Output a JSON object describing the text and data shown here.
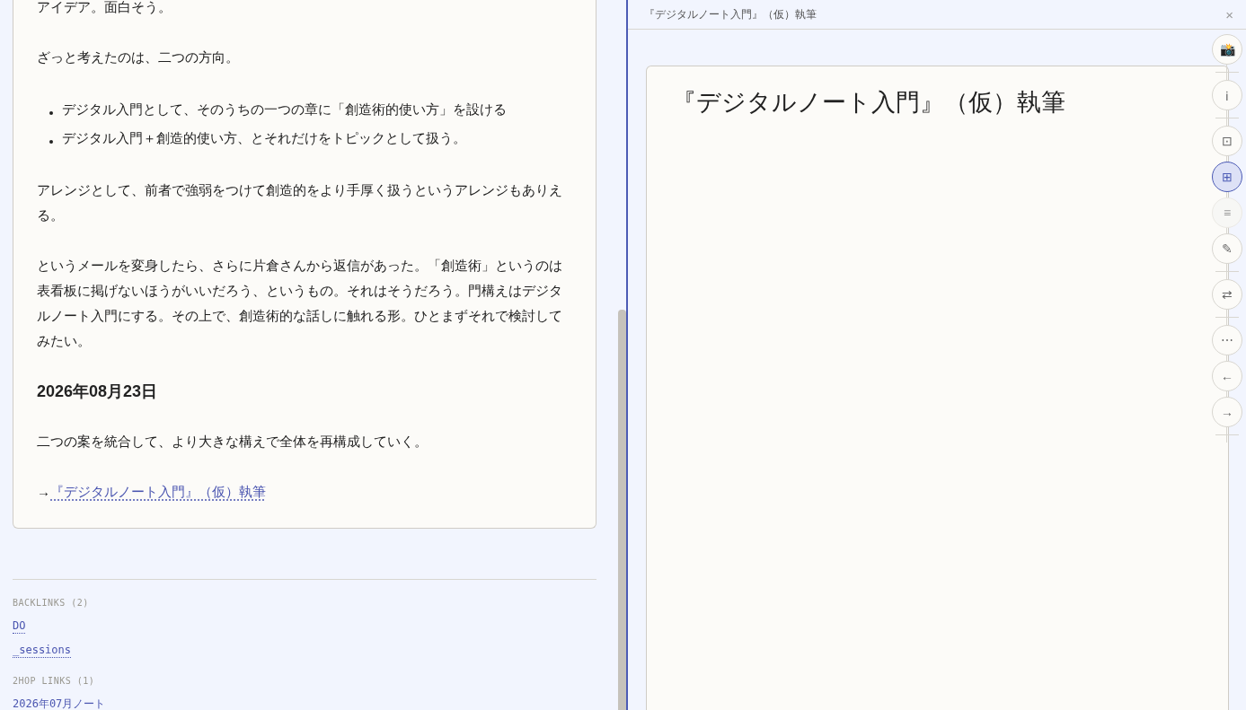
{
  "note": {
    "blocks": [
      {
        "kind": "p",
        "text": "アイデア。面白そう。"
      },
      {
        "kind": "p",
        "text": "ざっと考えたのは、二つの方向。"
      },
      {
        "kind": "ul",
        "items": [
          "デジタル入門として、そのうちの一つの章に「創造術的使い方」を設ける",
          "デジタル入門＋創造的使い方、とそれだけをトピックとして扱う。"
        ]
      },
      {
        "kind": "p",
        "text": "アレンジとして、前者で強弱をつけて創造的をより手厚く扱うというアレンジもありえる。"
      },
      {
        "kind": "p",
        "text": "というメールを変身したら、さらに片倉さんから返信があった。「創造術」というのは表看板に掲げないほうがいいだろう、というもの。それはそうだろう。門構えはデジタルノート入門にする。その上で、創造術的な話しに触れる形。ひとまずそれで検討してみたい。"
      },
      {
        "kind": "h",
        "text": "2026年08月23日"
      },
      {
        "kind": "p",
        "text": "二つの案を統合して、より大きな構えで全体を再構成していく。"
      },
      {
        "kind": "link",
        "prefix": "→",
        "text": "『デジタルノート入門』（仮）執筆"
      }
    ]
  },
  "links": [
    {
      "heading": "BACKLINKS (2)",
      "items": [
        "DO",
        "_sessions"
      ]
    },
    {
      "heading": "2HOP LINKS (1)",
      "items": [
        "2026年07月ノート"
      ]
    }
  ],
  "preview": {
    "title": "『デジタルノート入門』（仮）執筆",
    "close": "×",
    "heading": "『デジタルノート入門』（仮）執筆"
  },
  "rail": [
    [
      {
        "icon": "📸",
        "selected": false,
        "disabled": false
      }
    ],
    [
      {
        "icon": "ℹ",
        "selected": false,
        "disabled": false
      }
    ],
    [
      {
        "icon": "⊡",
        "selected": false,
        "disabled": false
      },
      {
        "icon": "⊞",
        "selected": true,
        "disabled": false
      },
      {
        "icon": "≡",
        "selected": false,
        "disabled": true
      },
      {
        "icon": "✎",
        "selected": false,
        "disabled": false
      }
    ],
    [
      {
        "icon": "⇄",
        "selected": false,
        "disabled": false
      }
    ],
    [
      {
        "icon": "⋯",
        "selected": false,
        "disabled": false
      },
      {
        "icon": "←",
        "selected": false,
        "disabled": false
      },
      {
        "icon": "→",
        "selected": false,
        "disabled": false
      }
    ]
  ]
}
